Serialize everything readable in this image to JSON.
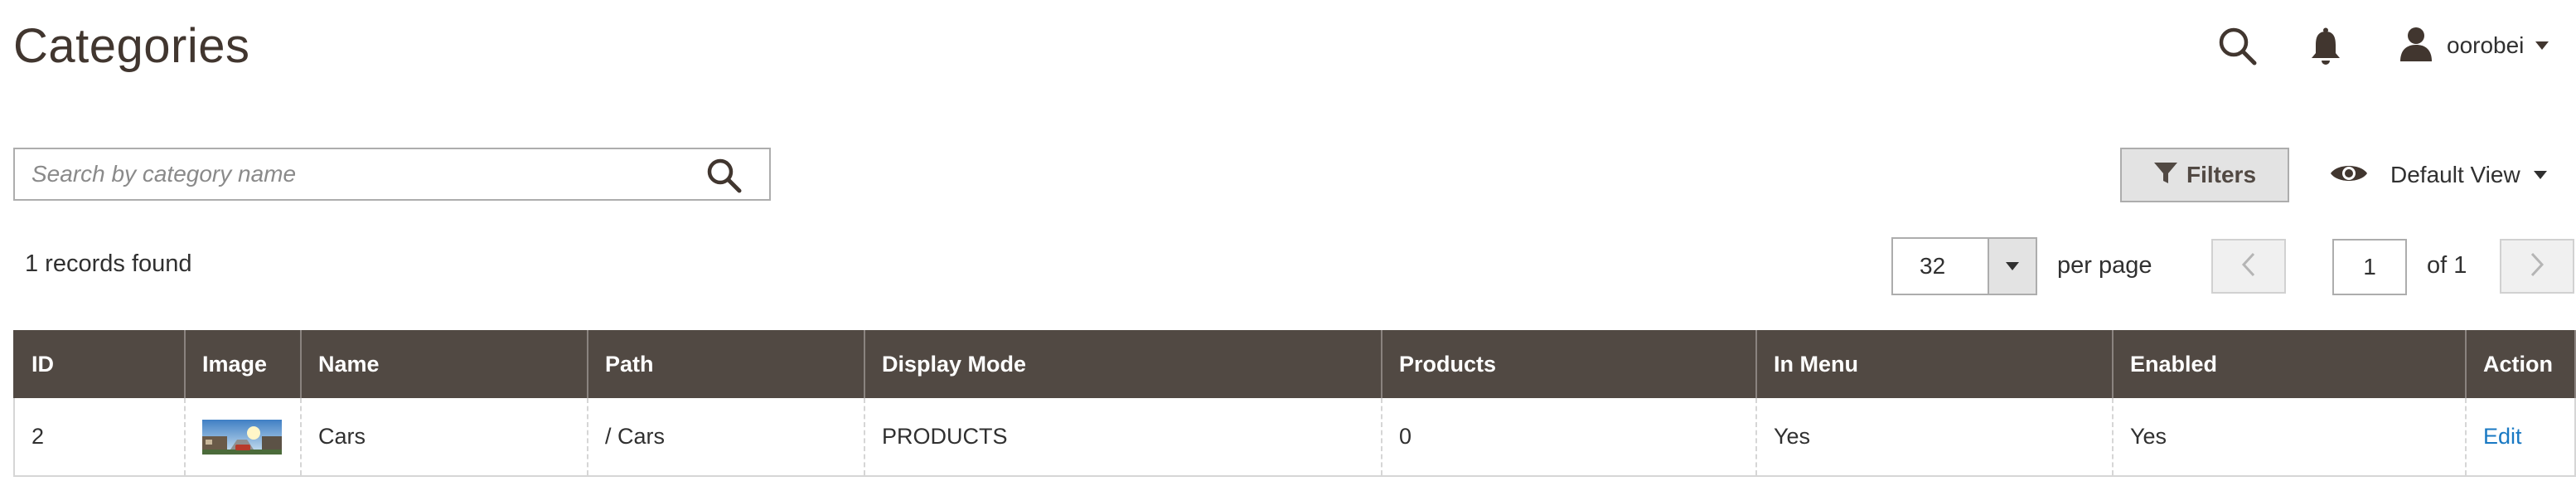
{
  "page": {
    "title": "Categories"
  },
  "header": {
    "username": "oorobei"
  },
  "search": {
    "placeholder": "Search by category name",
    "value": ""
  },
  "toolbar": {
    "filters_label": "Filters",
    "view_label": "Default View",
    "records_found": "1 records found",
    "per_page_value": "32",
    "per_page_label": "per page",
    "current_page": "1",
    "page_of": "of 1"
  },
  "table": {
    "columns": [
      "ID",
      "Image",
      "Name",
      "Path",
      "Display Mode",
      "Products",
      "In Menu",
      "Enabled",
      "Action"
    ],
    "rows": [
      {
        "id": "2",
        "image": "category-thumbnail",
        "name": "Cars",
        "path": "/ Cars",
        "display_mode": "PRODUCTS",
        "products": "0",
        "in_menu": "Yes",
        "enabled": "Yes",
        "action": "Edit"
      }
    ]
  },
  "colors": {
    "header_bg": "#514943",
    "link": "#1979c3",
    "title": "#41362f"
  },
  "icons": [
    "search-icon",
    "bell-icon",
    "user-icon",
    "filter-icon",
    "eye-icon",
    "chevron-left-icon",
    "chevron-right-icon"
  ]
}
